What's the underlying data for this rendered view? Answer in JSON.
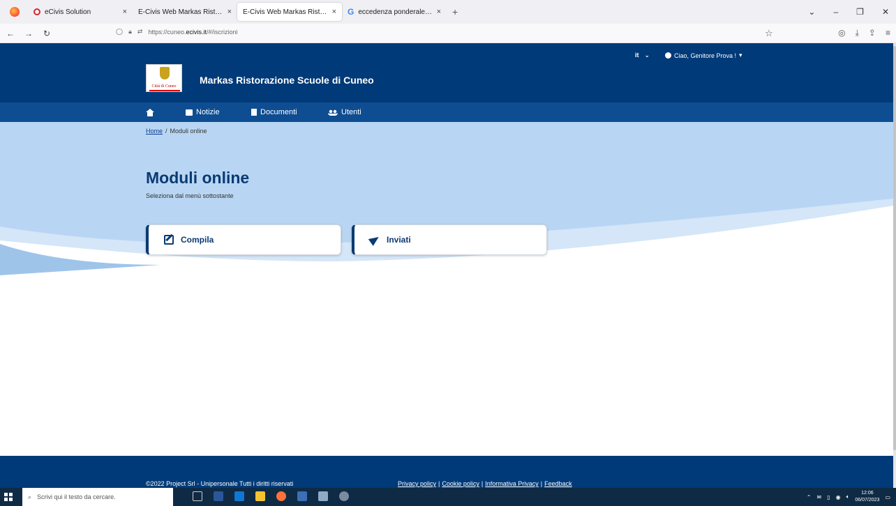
{
  "browser": {
    "tabs": [
      {
        "label": "eCivis Solution"
      },
      {
        "label": "E-Civis Web Markas Ristorazione Scuole di Cuneo"
      },
      {
        "label": "E-Civis Web Markas Ristorazione Scuole di Cuneo"
      },
      {
        "label": "eccedenza ponderale - Cerca con Google"
      }
    ],
    "url_prefix": "https://cuneo.",
    "url_domain": "ecivis.it",
    "url_path": "/#/iscrizioni"
  },
  "header": {
    "site_title": "Markas Ristorazione Scuole di Cuneo",
    "logo_caption": "Città di Cuneo",
    "language": "it",
    "user_greeting": "Ciao, Genitore Prova !"
  },
  "menu": {
    "notizie": "Notizie",
    "documenti": "Documenti",
    "utenti": "Utenti"
  },
  "breadcrumb": {
    "home": "Home",
    "separator": "/",
    "current": "Moduli online"
  },
  "main": {
    "title": "Moduli online",
    "subtitle": "Seleziona dal menù sottostante",
    "cards": [
      {
        "label": "Compila"
      },
      {
        "label": "Inviati"
      }
    ]
  },
  "footer": {
    "copyright": "©2022 Project Srl - Unipersonale Tutti i diritti riservati",
    "links": [
      "Privacy policy",
      "Cookie policy",
      "Informativa Privacy",
      "Feedback"
    ],
    "separator": "|"
  },
  "taskbar": {
    "search_placeholder": "Scrivi qui il testo da cercare.",
    "time": "12:06",
    "date": "06/07/2023"
  },
  "colors": {
    "header": "#003a78",
    "menu": "#0e4d92",
    "hero": "#b8d6f3",
    "accent": "#0b3a73"
  }
}
